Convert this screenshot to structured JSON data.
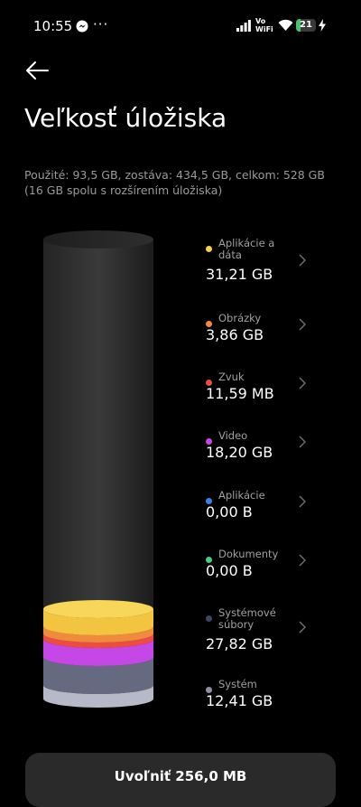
{
  "status": {
    "time": "10:55",
    "dots": "···",
    "vowifi_top": "Vo",
    "vowifi_bottom": "WiFi",
    "battery": "21"
  },
  "page": {
    "title": "Veľkosť úložiska",
    "summary_line1": "Použité: 93,5 GB, zostáva: 434,5 GB, celkom: 528 GB",
    "summary_line2": "(16 GB spolu s rozšírením úložiska)"
  },
  "categories": [
    {
      "label": "Aplikácie a dáta",
      "size": "31,21 GB",
      "color": "#f6d04d"
    },
    {
      "label": "Obrázky",
      "size": "3,86 GB",
      "color": "#f08a3c"
    },
    {
      "label": "Zvuk",
      "size": "11,59 MB",
      "color": "#ec4d40"
    },
    {
      "label": "Video",
      "size": "18,20 GB",
      "color": "#c547e5"
    },
    {
      "label": "Aplikácie",
      "size": "0,00 B",
      "color": "#3f7ee8"
    },
    {
      "label": "Dokumenty",
      "size": "0,00 B",
      "color": "#3fd07a"
    },
    {
      "label": "Systémové súbory",
      "size": "27,82 GB",
      "color": "#404660"
    },
    {
      "label": "Systém",
      "size": "12,41 GB",
      "color": "#8c8fa3"
    }
  ],
  "free_button": {
    "label": "Uvoľniť 256,0 MB"
  },
  "icons": {
    "back": "arrow-left-icon",
    "chevron": "chevron-right-icon",
    "messenger": "messenger-icon",
    "signal": "signal-icon",
    "wifi": "wifi-icon",
    "charging": "bolt-icon"
  }
}
